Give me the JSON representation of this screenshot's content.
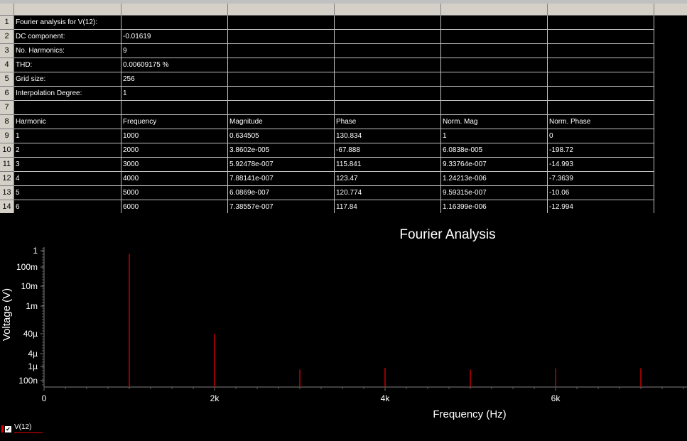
{
  "sheet": {
    "rows": [
      {
        "n": "1",
        "cells": [
          "Fourier analysis for V(12):",
          "",
          "",
          "",
          "",
          ""
        ]
      },
      {
        "n": "2",
        "cells": [
          "DC component:",
          "-0.01619",
          "",
          "",
          "",
          ""
        ]
      },
      {
        "n": "3",
        "cells": [
          "No. Harmonics:",
          "9",
          "",
          "",
          "",
          ""
        ]
      },
      {
        "n": "4",
        "cells": [
          "THD:",
          "0.00609175 %",
          "",
          "",
          "",
          ""
        ]
      },
      {
        "n": "5",
        "cells": [
          "Grid size:",
          "256",
          "",
          "",
          "",
          ""
        ]
      },
      {
        "n": "6",
        "cells": [
          "Interpolation Degree:",
          "1",
          "",
          "",
          "",
          ""
        ]
      },
      {
        "n": "7",
        "cells": [
          "",
          "",
          "",
          "",
          "",
          ""
        ]
      },
      {
        "n": "8",
        "cells": [
          "Harmonic",
          "Frequency",
          "Magnitude",
          "Phase",
          "Norm. Mag",
          "Norm. Phase"
        ]
      },
      {
        "n": "9",
        "cells": [
          "1",
          "1000",
          "0.634505",
          "130.834",
          "1",
          "0"
        ]
      },
      {
        "n": "10",
        "cells": [
          "2",
          "2000",
          "3.8602e-005",
          "-67.888",
          "6.0838e-005",
          "-198.72"
        ]
      },
      {
        "n": "11",
        "cells": [
          "3",
          "3000",
          "5.92478e-007",
          "115.841",
          "9.33764e-007",
          "-14.993"
        ]
      },
      {
        "n": "12",
        "cells": [
          "4",
          "4000",
          "7.88141e-007",
          "123.47",
          "1.24213e-006",
          "-7.3639"
        ]
      },
      {
        "n": "13",
        "cells": [
          "5",
          "5000",
          "6.0869e-007",
          "120.774",
          "9.59315e-007",
          "-10.06"
        ]
      },
      {
        "n": "14",
        "cells": [
          "6",
          "6000",
          "7.38557e-007",
          "117.84",
          "1.16399e-006",
          "-12.994"
        ]
      }
    ]
  },
  "chart_data": {
    "type": "bar",
    "title": "Fourier Analysis",
    "xlabel": "Frequency (Hz)",
    "ylabel": "Voltage (V)",
    "x_ticks": [
      "0",
      "2k",
      "4k",
      "6k"
    ],
    "y_ticks": [
      "1",
      "100m",
      "10m",
      "1m",
      "40µ",
      "4µ",
      "1µ",
      "100n"
    ],
    "y_scale": "log",
    "xlim": [
      0,
      7700
    ],
    "ylim": [
      1e-07,
      1.2
    ],
    "series": [
      {
        "name": "V(12)",
        "color": "#e00000",
        "x": [
          1000,
          2000,
          3000,
          4000,
          5000,
          6000,
          7000
        ],
        "values": [
          0.634505,
          3.8602e-05,
          5.92478e-07,
          7.88141e-07,
          6.0869e-07,
          7.38557e-07,
          7.5e-07
        ]
      }
    ],
    "legend": [
      "V(12)"
    ],
    "legend_position": "bottom-left",
    "grid": false,
    "background": "#000000"
  },
  "colors": {
    "trace": "#e00000",
    "axis": "#808080",
    "text": "#ffffff"
  }
}
